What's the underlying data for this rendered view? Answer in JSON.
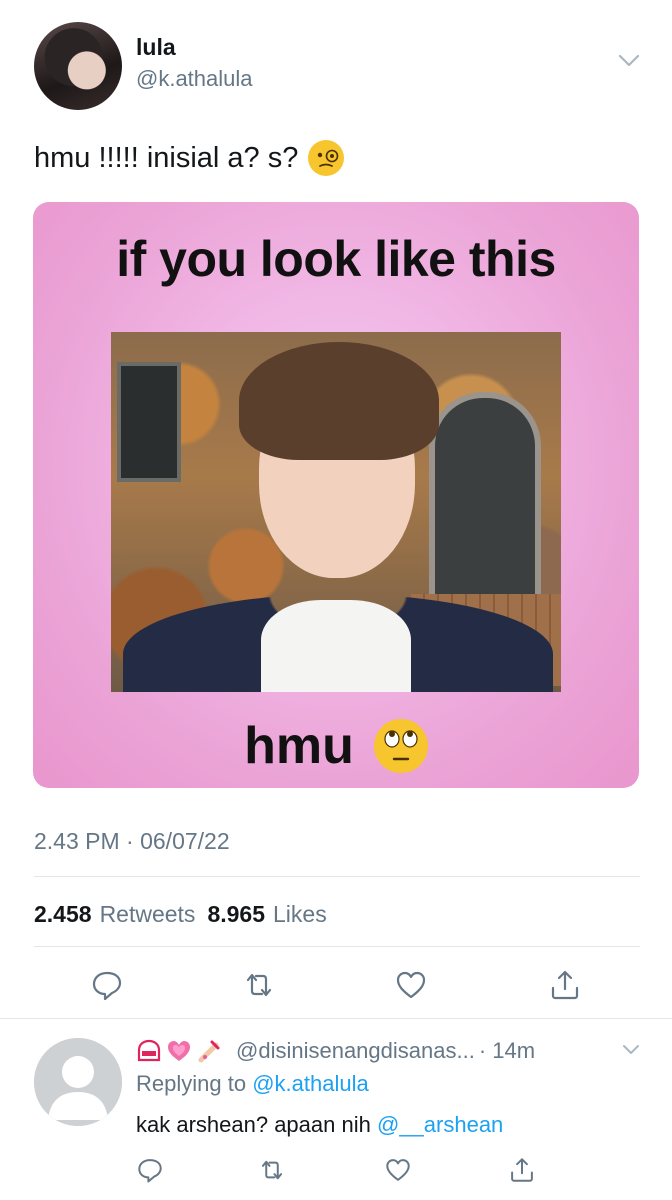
{
  "author": {
    "name": "lula",
    "handle": "@k.athalula"
  },
  "tweet": {
    "text": "hmu !!!!! inisial a? s?",
    "text_emoji": "face-with-monocle-icon",
    "media": {
      "top_caption": "if you look like this",
      "bottom_caption": "hmu",
      "bottom_emoji": "face-with-rolling-eyes-icon",
      "background_color": "#eba3d6"
    },
    "timestamp": "2.43 PM · 06/07/22",
    "retweets_count": "2.458",
    "retweets_label": "Retweets",
    "likes_count": "8.965",
    "likes_label": "Likes"
  },
  "actions": [
    "reply-icon",
    "retweet-icon",
    "like-icon",
    "share-icon"
  ],
  "reply": {
    "emojis": [
      "nameplate-emoji",
      "growing-heart-emoji",
      "nail-polish-emoji"
    ],
    "handle": "@disinisenangdisanas...",
    "time": "· 14m",
    "replying_prefix": "Replying to",
    "replying_to": "@k.athalula",
    "text": "kak arshean? apaan nih",
    "mention": "@__arshean"
  },
  "colors": {
    "accent": "#1da1f2",
    "secondary_text": "#657786",
    "divider": "#e1e8ed"
  }
}
